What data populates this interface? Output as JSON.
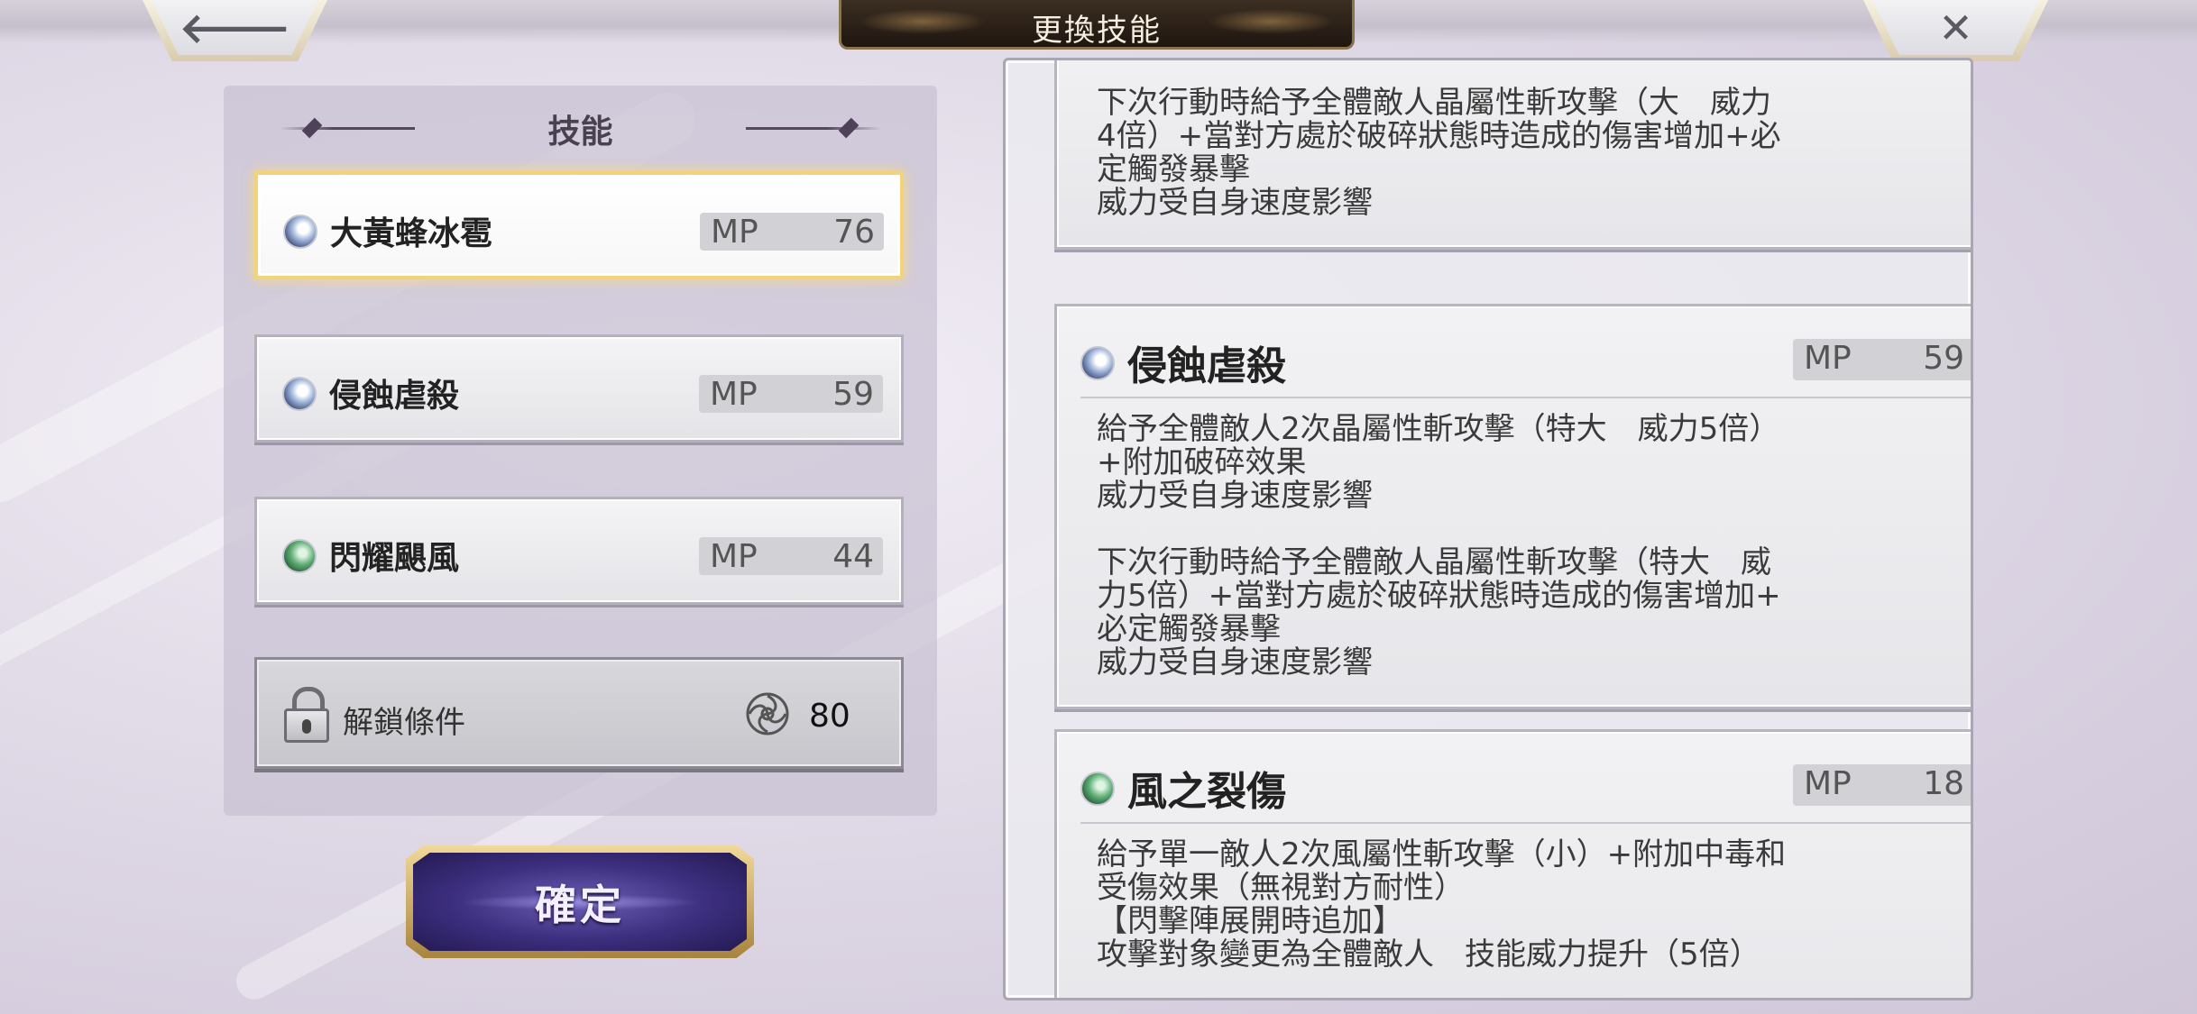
{
  "header": {
    "title": "更換技能",
    "back_glyph": "🡐",
    "close_glyph": "✕"
  },
  "skill_panel": {
    "heading": "技能",
    "items": [
      {
        "name": "大黃蜂冰雹",
        "mp_label": "MP",
        "mp": "76",
        "element": "crystal",
        "selected": true
      },
      {
        "name": "侵蝕虐殺",
        "mp_label": "MP",
        "mp": "59",
        "element": "crystal",
        "selected": false
      },
      {
        "name": "閃耀颶風",
        "mp_label": "MP",
        "mp": "44",
        "element": "wind",
        "selected": false
      }
    ],
    "locked": {
      "label": "解鎖條件",
      "icon": "swirl-icon",
      "value": "80"
    }
  },
  "confirm": {
    "label": "確定"
  },
  "details": {
    "cards": [
      {
        "lines": [
          "下次行動時給予全體敵人晶屬性斬攻擊（大　威力",
          "4倍）+當對方處於破碎狀態時造成的傷害增加+必",
          "定觸發暴擊",
          "威力受自身速度影響"
        ]
      },
      {
        "name": "侵蝕虐殺",
        "mp_label": "MP",
        "mp": "59",
        "element": "crystal",
        "lines": [
          "給予全體敵人2次晶屬性斬攻擊（特大　威力5倍）",
          "+附加破碎效果",
          "威力受自身速度影響",
          "",
          "下次行動時給予全體敵人晶屬性斬攻擊（特大　威",
          "力5倍）+當對方處於破碎狀態時造成的傷害增加+",
          "必定觸發暴擊",
          "威力受自身速度影響"
        ]
      },
      {
        "name": "風之裂傷",
        "mp_label": "MP",
        "mp": "18",
        "element": "wind",
        "lines": [
          "給予單一敵人2次風屬性斬攻擊（小）+附加中毒和",
          "受傷效果（無視對方耐性）",
          "【閃擊陣展開時追加】",
          "攻擊對象變更為全體敵人　技能威力提升（5倍）"
        ]
      }
    ]
  },
  "colors": {
    "selected_border": "#f2d27a",
    "confirm_fill": "#3c2e7e",
    "crystal": "#9db3d8",
    "wind": "#5fae76"
  }
}
